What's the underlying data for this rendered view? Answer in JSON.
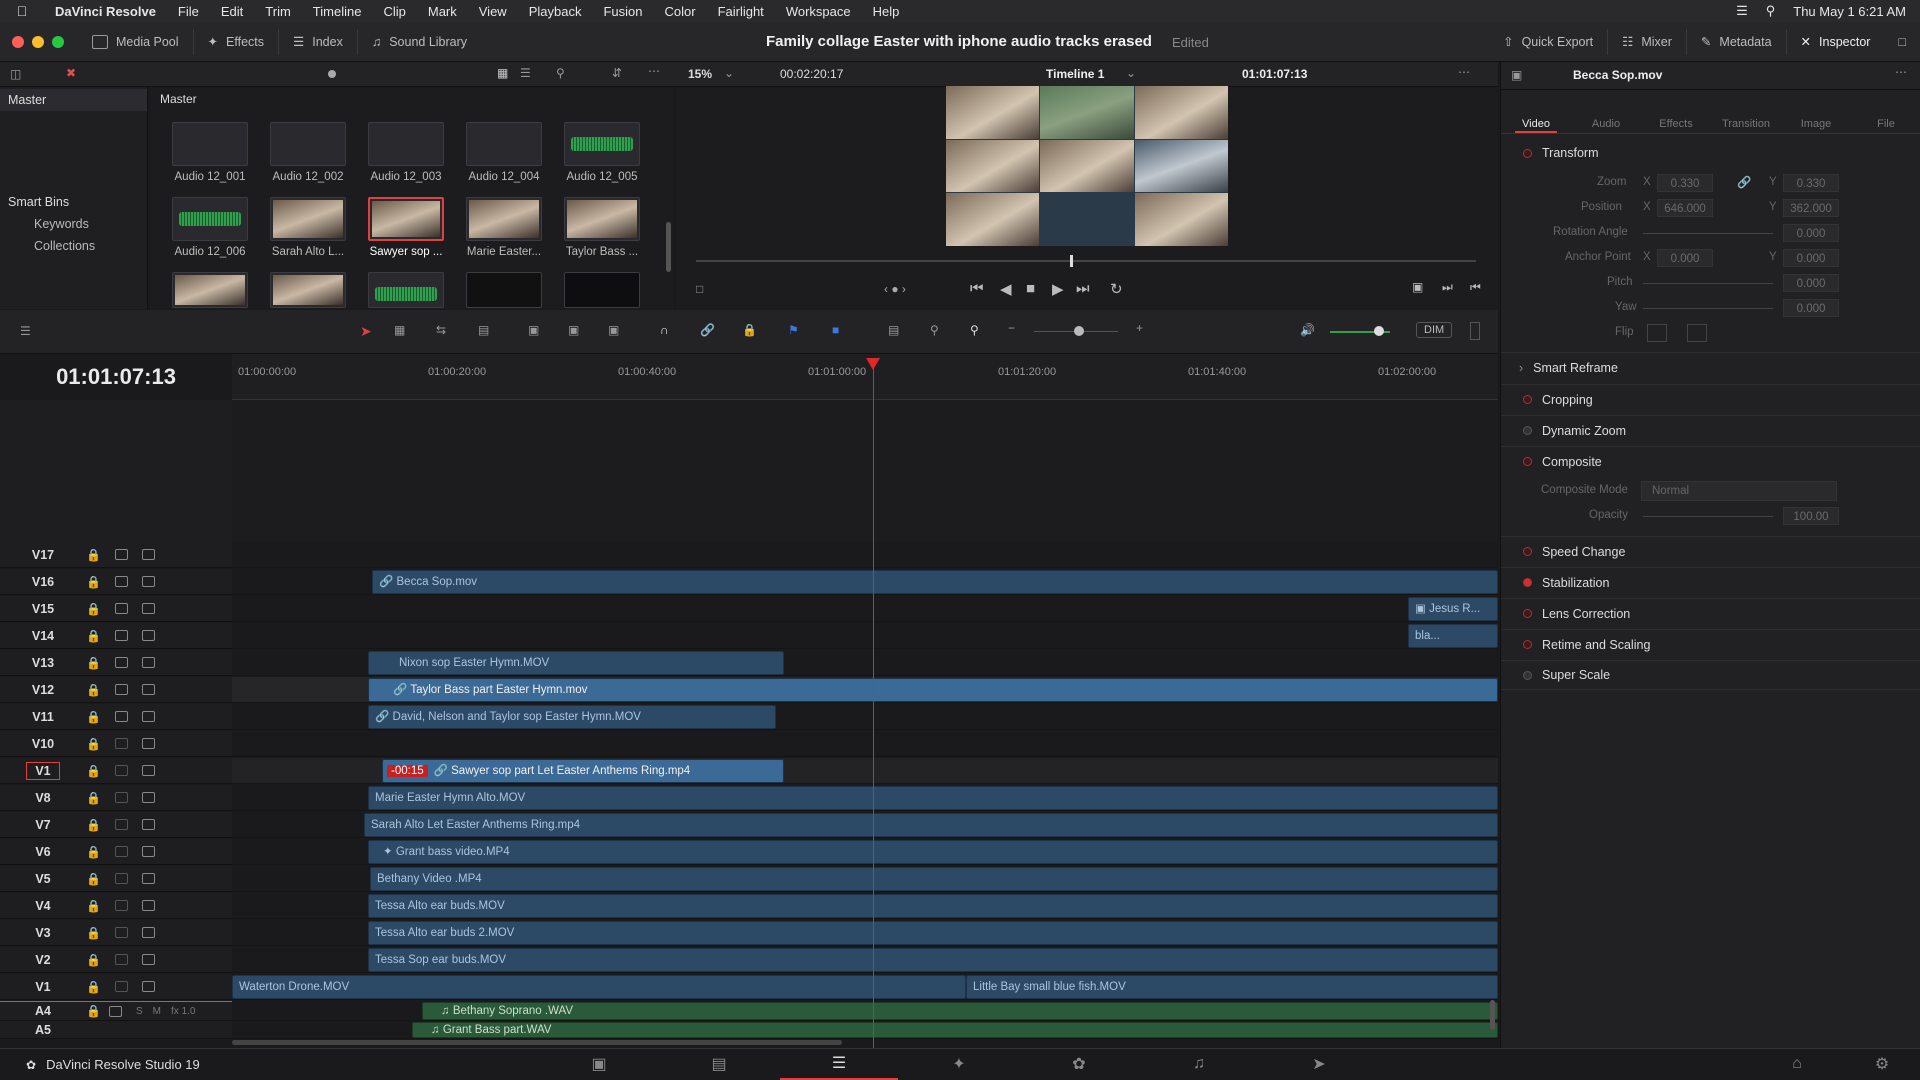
{
  "menubar": {
    "app": "DaVinci Resolve",
    "items": [
      "File",
      "Edit",
      "Trim",
      "Timeline",
      "Clip",
      "Mark",
      "View",
      "Playback",
      "Fusion",
      "Color",
      "Fairlight",
      "Workspace",
      "Help"
    ],
    "clock": "Thu May 1  6:21 AM"
  },
  "toolbar": {
    "media_pool": "Media Pool",
    "effects": "Effects",
    "index": "Index",
    "sound_library": "Sound Library",
    "project_title": "Family collage Easter with iphone audio tracks erased",
    "edited": "Edited",
    "quick_export": "Quick Export",
    "mixer": "Mixer",
    "metadata": "Metadata",
    "inspector": "Inspector"
  },
  "media_pool": {
    "bin_header": "Master",
    "thumb_header": "Master",
    "smart_bins": "Smart Bins",
    "keywords": "Keywords",
    "collections": "Collections",
    "clips": [
      "Audio 12_001",
      "Audio 12_002",
      "Audio 12_003",
      "Audio 12_004",
      "Audio 12_005",
      "Audio 12_006",
      "Sarah Alto L...",
      "Sawyer sop ...",
      "Marie Easter...",
      "Taylor Bass ..."
    ]
  },
  "viewer": {
    "zoom": "15%",
    "duration": "00:02:20:17",
    "timeline_name": "Timeline 1",
    "timecode": "01:01:07:13"
  },
  "inspector": {
    "clip_name": "Becca Sop.mov",
    "tabs": [
      "Video",
      "Audio",
      "Effects",
      "Transition",
      "Image",
      "File"
    ],
    "transform": "Transform",
    "zoom_label": "Zoom",
    "zoom_x": "0.330",
    "zoom_y": "0.330",
    "position_label": "Position",
    "pos_x": "646.000",
    "pos_y": "362.000",
    "rotation_label": "Rotation Angle",
    "rotation": "0.000",
    "anchor_label": "Anchor Point",
    "anchor_x": "0.000",
    "anchor_y": "0.000",
    "pitch_label": "Pitch",
    "pitch": "0.000",
    "yaw_label": "Yaw",
    "yaw": "0.000",
    "flip_label": "Flip",
    "smart_reframe": "Smart Reframe",
    "cropping": "Cropping",
    "dynamic_zoom": "Dynamic Zoom",
    "composite": "Composite",
    "composite_mode_label": "Composite Mode",
    "composite_mode": "Normal",
    "opacity_label": "Opacity",
    "opacity": "100.00",
    "speed_change": "Speed Change",
    "stabilization": "Stabilization",
    "lens_correction": "Lens Correction",
    "retime": "Retime and Scaling",
    "super_scale": "Super Scale"
  },
  "timeline": {
    "timecode": "01:01:07:13",
    "dim": "DIM",
    "ruler": [
      "01:00:00:00",
      "01:00:20:00",
      "01:00:40:00",
      "01:01:00:00",
      "01:01:20:00",
      "01:01:40:00",
      "01:02:00:00"
    ],
    "tracks": [
      "V17",
      "V16",
      "V15",
      "V14",
      "V13",
      "V12",
      "V11",
      "V10",
      "V1",
      "V8",
      "V7",
      "V6",
      "V5",
      "V4",
      "V3",
      "V2",
      "V1"
    ],
    "clips": {
      "becca": "Becca Sop.mov",
      "jesus": "Jesus R...",
      "bla": "bla...",
      "nixon": "Nixon sop Easter Hymn.MOV",
      "taylor": "Taylor Bass part Easter Hymn.mov",
      "david": "David, Nelson and Taylor sop Easter Hymn.MOV",
      "sawyer_offset": "-00:15",
      "sawyer": "Sawyer sop part Let Easter Anthems Ring.mp4",
      "marie": "Marie Easter Hymn Alto.MOV",
      "sarah": "Sarah Alto Let Easter Anthems Ring.mp4",
      "grant": "Grant bass video.MP4",
      "bethany": "Bethany Video .MP4",
      "tessa1": "Tessa Alto ear buds.MOV",
      "tessa2": "Tessa Alto ear buds 2.MOV",
      "tessa3": "Tessa Sop ear buds.MOV",
      "waterton": "Waterton Drone.MOV",
      "littlebay": "Little Bay small blue fish.MOV",
      "bethany_aud": "Bethany Soprano .WAV",
      "grant_aud": "Grant Bass part.WAV"
    },
    "audio_tracks": [
      "A4",
      "A5"
    ],
    "audio_s": "S",
    "audio_m": "M",
    "audio_fx": "fx 1.0"
  },
  "footer": {
    "app_name": "DaVinci Resolve Studio 19"
  }
}
